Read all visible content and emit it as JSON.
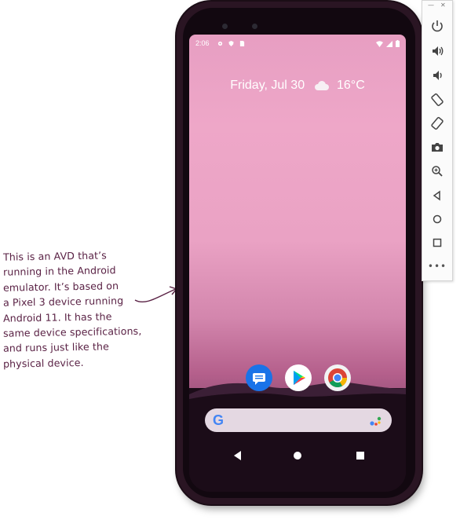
{
  "annotation": {
    "lines": [
      "This is an AVD that’s",
      "running in the Android",
      "emulator. It’s based on",
      "a Pixel 3 device running",
      "Android 11. It has the",
      "same device specifications,",
      "and runs just like the",
      "physical device."
    ]
  },
  "device": {
    "status_bar": {
      "time": "2:06"
    },
    "glance": {
      "date": "Friday, Jul 30",
      "weather_icon": "cloud-icon",
      "temperature": "16°C"
    },
    "dock_apps": [
      "messages-icon",
      "play-store-icon",
      "chrome-icon"
    ],
    "search": {
      "logo": "G"
    },
    "navigation": [
      "back-icon",
      "home-icon",
      "recents-icon"
    ]
  },
  "emulator_toolbar": {
    "buttons": [
      "power-icon",
      "volume-up-icon",
      "volume-down-icon",
      "rotate-left-icon",
      "rotate-right-icon",
      "camera-icon",
      "zoom-icon",
      "back-icon",
      "home-icon",
      "overview-icon"
    ],
    "more_label": "•••"
  },
  "colors": {
    "ink": "#5a2245",
    "wallpaper_top": "#e79ec2",
    "wallpaper_bottom": "#1a0b17",
    "toolbar_icon": "#444444"
  }
}
